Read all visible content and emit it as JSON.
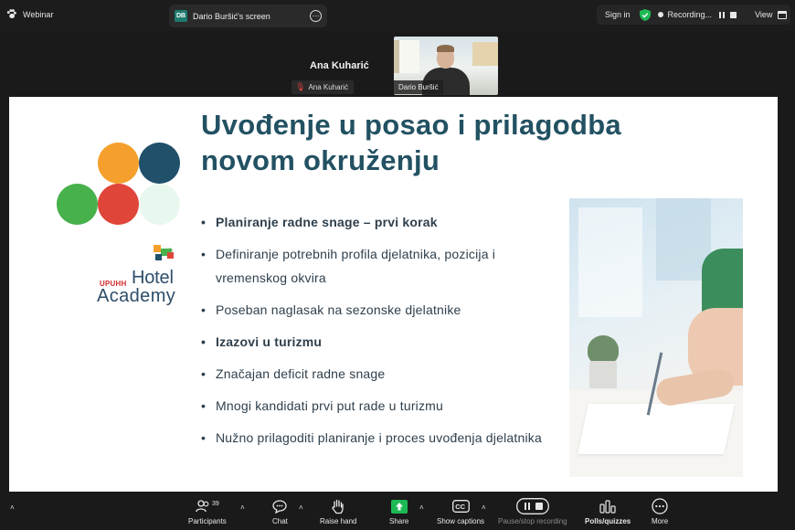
{
  "app": {
    "name": "Webinar"
  },
  "screen_tab": {
    "badge": "DB",
    "title": "Dario Buršić's screen"
  },
  "top_right": {
    "sign_in": "Sign in",
    "recording": "Recording...",
    "view": "View"
  },
  "participants_row": {
    "active_name": "Ana Kuharić",
    "active_tag": "Ana Kuharić",
    "video_tag": "Dario Buršić"
  },
  "slide": {
    "title": "Uvođenje u posao i prilagodba novom okruženju",
    "logo": {
      "small": "UPUHH",
      "line1": "Hotel",
      "line2": "Academy"
    },
    "dot_colors": [
      "#f5a02d",
      "#20506a",
      "#47b14c",
      "#e0453a",
      "#e9f8ee"
    ],
    "bullets": [
      {
        "text": "Planiranje radne snage – prvi korak",
        "bold": true
      },
      {
        "text": "Definiranje potrebnih profila djelatnika, pozicija i vremenskog okvira",
        "bold": false
      },
      {
        "text": "Poseban naglasak na sezonske djelatnike",
        "bold": false
      },
      {
        "text": "Izazovi u turizmu",
        "bold": true
      },
      {
        "text": "Značajan deficit radne snage",
        "bold": false
      },
      {
        "text": "Mnogi kandidati prvi put rade u turizmu",
        "bold": false
      },
      {
        "text": "Nužno prilagoditi planiranje i proces uvođenja djelatnika",
        "bold": false
      }
    ]
  },
  "toolbar": {
    "participants_label": "Participants",
    "participants_count": "39",
    "chat_label": "Chat",
    "raise_hand_label": "Raise hand",
    "share_label": "Share",
    "captions_label": "Show captions",
    "recording_label": "Pause/stop recording",
    "polls_label": "Polls/quizzes",
    "more_label": "More"
  },
  "colors": {
    "title": "#225162",
    "share_green": "#1db954",
    "muted_red": "#e0443c"
  }
}
